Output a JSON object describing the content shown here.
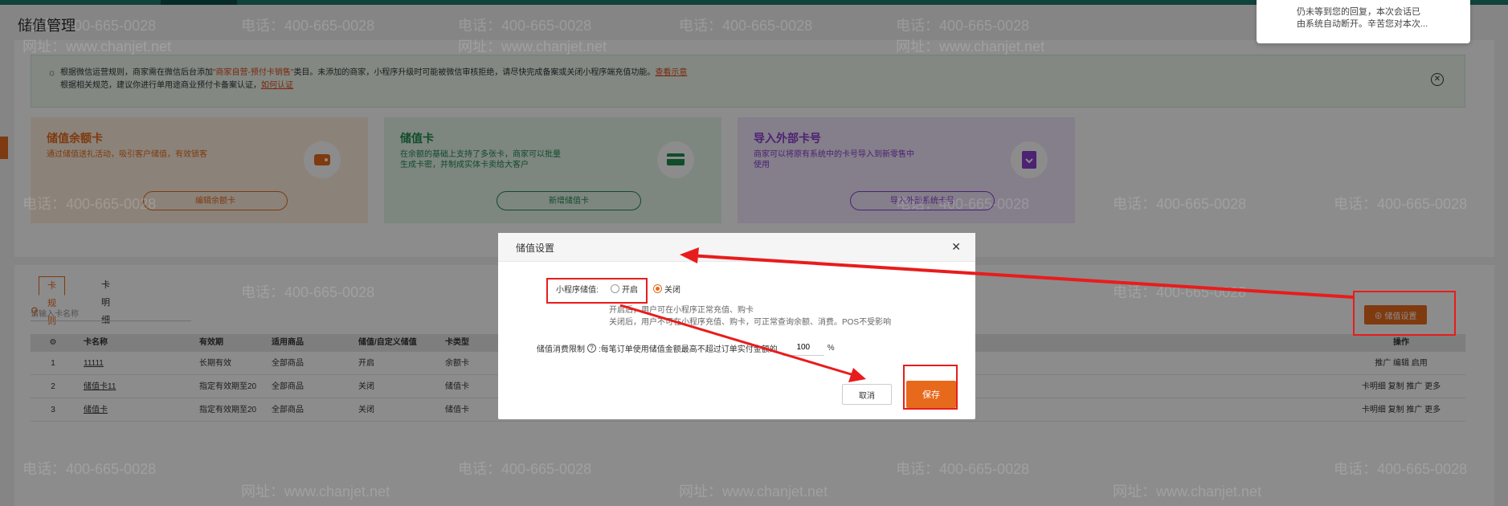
{
  "page": {
    "title": "储值管理"
  },
  "notice": {
    "line1_pre": "根据微信运营规则，商家需在微信后台添加",
    "line1_hl": "\"商家自营-预付卡销售\"",
    "line1_mid": "类目。未添加的商家，小程序升级时可能被微信审核拒绝，请尽快完成备案或关闭小程序端充值功能。",
    "line1_link": "查看示意",
    "line2_pre": "根据相关规范，建议你进行单用途商业预付卡备案认证，",
    "line2_link": "如何认证"
  },
  "cards": [
    {
      "title": "储值余额卡",
      "desc": "通过储值送礼活动，吸引客户储值，有效锁客",
      "button": "编辑余额卡",
      "icon": "wallet-icon"
    },
    {
      "title": "储值卡",
      "desc": "在余额的基础上支持了多张卡，商家可以批量生成卡密，并制成实体卡卖给大客户",
      "button": "新增储值卡",
      "icon": "card-icon"
    },
    {
      "title": "导入外部卡号",
      "desc": "商家可以将原有系统中的卡号导入到新零售中使用",
      "button": "导入外部系统卡号",
      "icon": "import-icon"
    }
  ],
  "tabs": [
    {
      "label": "卡规则"
    },
    {
      "label": "卡明细"
    }
  ],
  "search": {
    "placeholder": "请输入卡名称"
  },
  "settings_button": "储值设置",
  "table": {
    "headers": [
      "卡名称",
      "有效期",
      "适用商品",
      "储值/自定义储值",
      "卡类型",
      "操作"
    ],
    "rows": [
      {
        "index": "1",
        "name": "11111",
        "validity": "长期有效",
        "goods": "全部商品",
        "stored": "开启",
        "type": "余额卡",
        "ops": "推广 编辑 启用"
      },
      {
        "index": "2",
        "name": "储值卡11",
        "validity": "指定有效期至20",
        "goods": "全部商品",
        "stored": "关闭",
        "type": "储值卡",
        "ops": "卡明细 复制 推广 更多"
      },
      {
        "index": "3",
        "name": "储值卡",
        "validity": "指定有效期至20",
        "goods": "全部商品",
        "stored": "关闭",
        "type": "储值卡",
        "ops": "卡明细 复制 推广 更多"
      }
    ]
  },
  "chat_popup": {
    "line1": "仍未等到您的回复，本次会话已",
    "line2": "由系统自动断开。辛苦您对本次..."
  },
  "watermark": {
    "phone": "电话：400-665-0028",
    "site": "网址：www.chanjet.net"
  },
  "dialog": {
    "title": "储值设置",
    "miniprogram_label": "小程序储值:",
    "option_on": "开启",
    "option_off": "关闭",
    "selected": "关闭",
    "help_line1": "开启后，用户可在小程序正常充值、购卡",
    "help_line2": "关闭后，用户不可在小程序充值、购卡，可正常查询余额、消费。POS不受影响",
    "limit_label": "储值消费限制",
    "limit_text": ":每笔订单使用储值金额最高不超过订单实付金额的",
    "limit_value": "100",
    "limit_unit": "%",
    "cancel": "取消",
    "save": "保存"
  },
  "colors": {
    "accent": "#e76a1c",
    "annotation": "#e81c1c",
    "topbar": "#1c7a6c"
  }
}
